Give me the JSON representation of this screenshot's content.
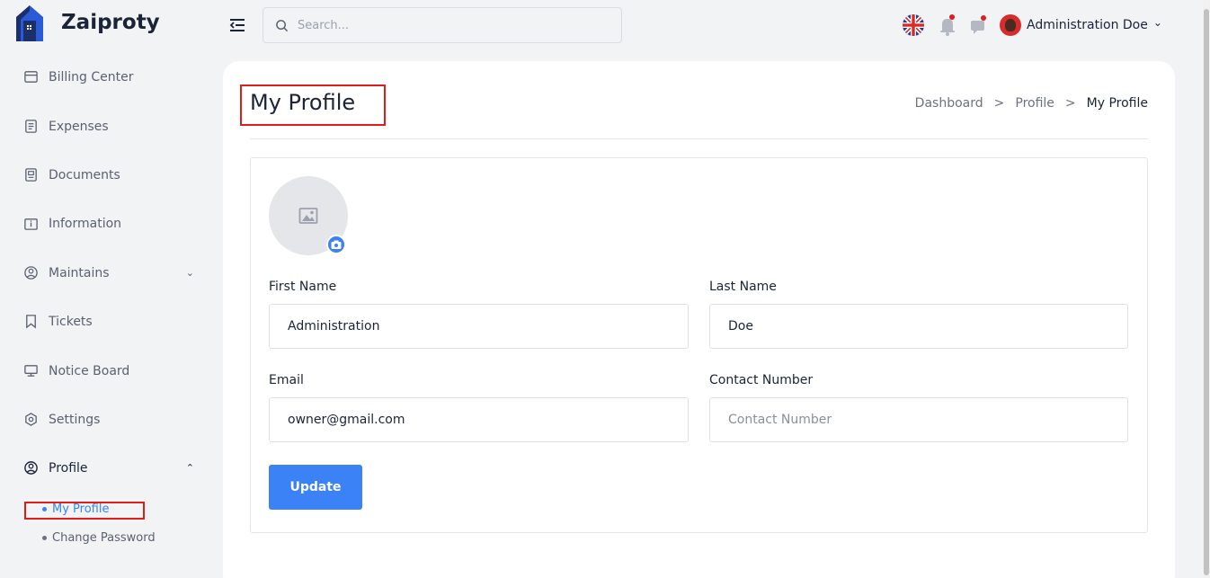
{
  "brand": {
    "name": "Zaiproty"
  },
  "search": {
    "placeholder": "Search..."
  },
  "user": {
    "name": "Administration Doe",
    "caret": "⌄"
  },
  "sidebar": {
    "items": [
      {
        "label": "Billing Center",
        "icon": "billing-icon"
      },
      {
        "label": "Expenses",
        "icon": "expenses-icon"
      },
      {
        "label": "Documents",
        "icon": "documents-icon"
      },
      {
        "label": "Information",
        "icon": "information-icon"
      },
      {
        "label": "Maintains",
        "icon": "maintains-icon",
        "chevron": "⌄"
      },
      {
        "label": "Tickets",
        "icon": "tickets-icon"
      },
      {
        "label": "Notice Board",
        "icon": "notice-board-icon"
      },
      {
        "label": "Settings",
        "icon": "settings-icon"
      },
      {
        "label": "Profile",
        "icon": "profile-icon",
        "chevron": "⌃"
      }
    ],
    "profile_sub": [
      {
        "label": "My Profile",
        "active": true
      },
      {
        "label": "Change Password",
        "active": false
      }
    ]
  },
  "page": {
    "title": "My Profile",
    "breadcrumb": [
      "Dashboard",
      "Profile",
      "My Profile"
    ],
    "breadcrumb_sep": ">"
  },
  "form": {
    "first_name": {
      "label": "First Name",
      "value": "Administration"
    },
    "last_name": {
      "label": "Last Name",
      "value": "Doe"
    },
    "email": {
      "label": "Email",
      "value": "owner@gmail.com"
    },
    "contact": {
      "label": "Contact Number",
      "placeholder": "Contact Number",
      "value": ""
    },
    "submit_label": "Update"
  },
  "colors": {
    "accent": "#3b82f6",
    "highlight": "#e21b1b",
    "text": "#1b2437"
  }
}
